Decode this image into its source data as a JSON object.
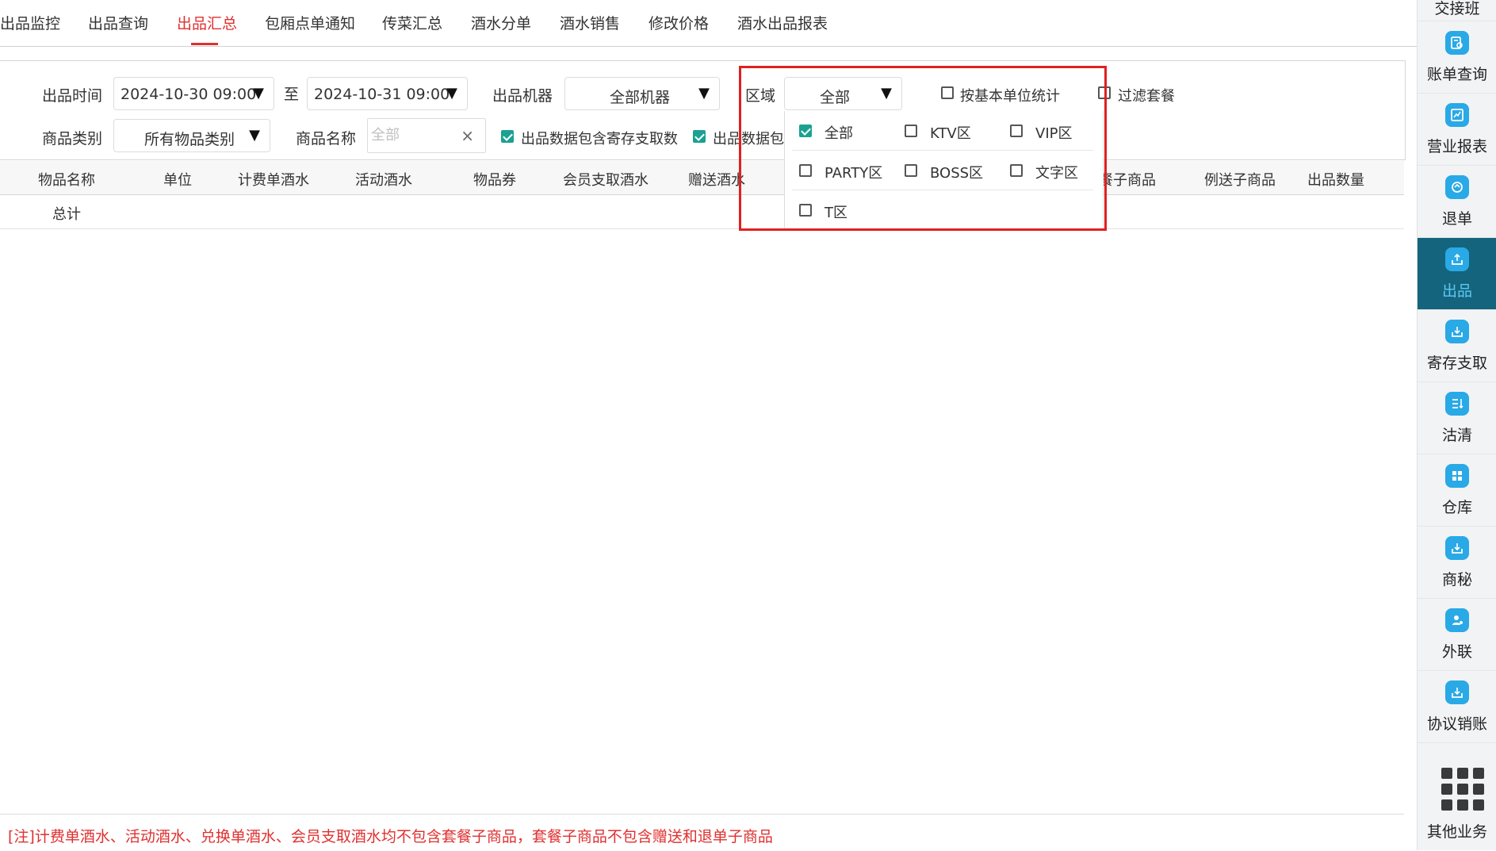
{
  "tabs": [
    {
      "label": "出品监控"
    },
    {
      "label": "出品查询"
    },
    {
      "label": "出品汇总"
    },
    {
      "label": "包厢点单通知"
    },
    {
      "label": "传菜汇总"
    },
    {
      "label": "酒水分单"
    },
    {
      "label": "酒水销售"
    },
    {
      "label": "修改价格"
    },
    {
      "label": "酒水出品报表"
    }
  ],
  "active_tab": "出品汇总",
  "filters": {
    "time_label": "出品时间",
    "time_start": "2024-10-30 09:00",
    "to_label": "至",
    "time_end": "2024-10-31 09:00",
    "machine_label": "出品机器",
    "machine_value": "全部机器",
    "area_label": "区域",
    "area_value": "全部",
    "base_unit_label": "按基本单位统计",
    "base_unit_checked": false,
    "filter_set_label": "过滤套餐",
    "filter_set_checked": false,
    "category_label": "商品类别",
    "category_value": "所有物品类别",
    "name_label": "商品名称",
    "name_placeholder": "全部",
    "include_storage_label": "出品数据包含寄存支取数",
    "include_storage_checked": true,
    "include_other_label": "出品数据包",
    "include_other_checked": true
  },
  "area_dropdown": {
    "options": [
      {
        "label": "全部",
        "checked": true
      },
      {
        "label": "KTV区",
        "checked": false
      },
      {
        "label": "VIP区",
        "checked": false
      },
      {
        "label": "PARTY区",
        "checked": false
      },
      {
        "label": "BOSS区",
        "checked": false
      },
      {
        "label": "文字区",
        "checked": false
      },
      {
        "label": "T区",
        "checked": false
      }
    ]
  },
  "table": {
    "columns": [
      "物品名称",
      "单位",
      "计费单酒水",
      "活动酒水",
      "物品券",
      "会员支取酒水",
      "赠送酒水",
      "套餐子商品",
      "例送子商品",
      "出品数量"
    ],
    "total_label": "总计"
  },
  "footer_note": "[注]计费单酒水、活动酒水、兑换单酒水、会员支取酒水均不包含套餐子商品，套餐子商品不包含赠送和退单子商品",
  "sidebar": {
    "top_label": "交接班",
    "items": [
      {
        "label": "账单查询",
        "icon": "bill-search-icon"
      },
      {
        "label": "营业报表",
        "icon": "business-report-icon"
      },
      {
        "label": "退单",
        "icon": "refund-icon"
      },
      {
        "label": "出品",
        "icon": "dispatch-icon"
      },
      {
        "label": "寄存支取",
        "icon": "storage-withdraw-icon"
      },
      {
        "label": "沽清",
        "icon": "sold-out-icon"
      },
      {
        "label": "仓库",
        "icon": "warehouse-icon"
      },
      {
        "label": "商秘",
        "icon": "secretary-icon"
      },
      {
        "label": "外联",
        "icon": "external-contact-icon"
      },
      {
        "label": "协议销账",
        "icon": "agreement-writeoff-icon"
      }
    ],
    "active_item": "出品",
    "other_label": "其他业务"
  },
  "colors": {
    "accent_red": "#e03030",
    "check_green": "#1aa191",
    "sidebar_active": "#14647e",
    "icon_blue": "#29a9e6"
  }
}
